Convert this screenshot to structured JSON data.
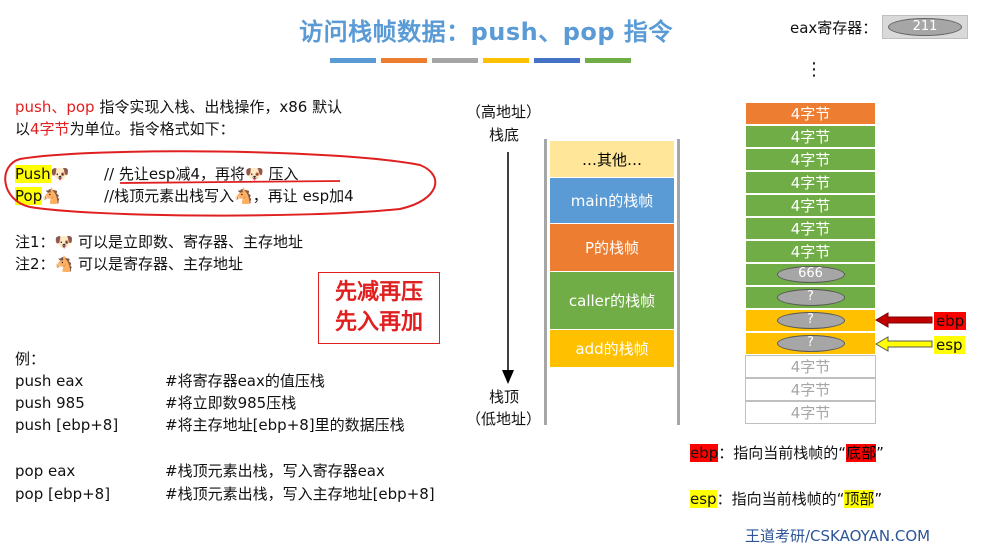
{
  "title": "访问栈帧数据：push、pop 指令",
  "title_bar_colors": [
    "#5B9BD5",
    "#ED7D31",
    "#A5A5A5",
    "#FFC000",
    "#4472C4",
    "#70AD47"
  ],
  "eax": {
    "label": "eax寄存器：",
    "value": "211"
  },
  "intro": {
    "line1_red": "push、pop",
    "line1_rest": " 指令实现入栈、出栈操作，x86 默认",
    "line2_pre": "以",
    "line2_red": "4字节",
    "line2_post": "为单位。指令格式如下："
  },
  "formats": {
    "push_label": "Push",
    "push_desc_a": "// 先让esp减4，再将",
    "push_desc_b": " 压入",
    "pop_label": "Pop",
    "pop_desc_a": "//栈顶元素出栈写入",
    "pop_desc_b": "，再让 esp加4"
  },
  "notes": {
    "note1_a": "注1：",
    "note1_b": " 可以是立即数、寄存器、主存地址",
    "note2_a": "注2：",
    "note2_b": " 可以是寄存器、主存地址"
  },
  "tip": {
    "line1": "先减再压",
    "line2": "先入再加"
  },
  "examples": {
    "header": "例：",
    "rows": [
      {
        "code": "push eax",
        "comment": "#将寄存器eax的值压栈"
      },
      {
        "code": "push 985",
        "comment": "#将立即数985压栈"
      },
      {
        "code": "push [ebp+8]",
        "comment": "#将主存地址[ebp+8]里的数据压栈"
      },
      {
        "code": "pop eax",
        "comment": "#栈顶元素出栈，写入寄存器eax"
      },
      {
        "code": "pop [ebp+8]",
        "comment": "#栈顶元素出栈，写入主存地址[ebp+8]"
      }
    ]
  },
  "mid_stack": {
    "top_label_1": "（高地址）",
    "top_label_2": "栈底",
    "bottom_label_1": "栈顶",
    "bottom_label_2": "（低地址）",
    "blocks": [
      {
        "label": "…其他…",
        "color": "#FFE699",
        "text_color": "#000000"
      },
      {
        "label": "main的栈帧",
        "color": "#5B9BD5",
        "text_color": "#ffffff"
      },
      {
        "label": "P的栈帧",
        "color": "#ED7D31",
        "text_color": "#ffffff"
      },
      {
        "label": "caller的栈帧",
        "color": "#70AD47",
        "text_color": "#ffffff"
      },
      {
        "label": "add的栈帧",
        "color": "#FFC000",
        "text_color": "#ffffff"
      }
    ]
  },
  "right_stack": {
    "ellipsis": "⋮",
    "cells": [
      {
        "label": "4字节",
        "style": "orange"
      },
      {
        "label": "4字节",
        "style": "green"
      },
      {
        "label": "4字节",
        "style": "green"
      },
      {
        "label": "4字节",
        "style": "green"
      },
      {
        "label": "4字节",
        "style": "green"
      },
      {
        "label": "4字节",
        "style": "green"
      },
      {
        "label": "4字节",
        "style": "green"
      },
      {
        "label": "666",
        "style": "green",
        "oval": true
      },
      {
        "label": "?",
        "style": "green",
        "oval": true
      },
      {
        "label": "?",
        "style": "yellow",
        "oval": true
      },
      {
        "label": "?",
        "style": "yellow",
        "oval": true
      },
      {
        "label": "4字节",
        "style": "empty"
      },
      {
        "label": "4字节",
        "style": "empty"
      },
      {
        "label": "4字节",
        "style": "empty"
      }
    ],
    "ebp_label": "ebp",
    "esp_label": "esp"
  },
  "legend": {
    "ebp_tag": "ebp",
    "ebp_text": "：指向当前栈帧的“",
    "ebp_key": "底部",
    "ebp_close": "”",
    "esp_tag": "esp",
    "esp_text": "：指向当前栈帧的“",
    "esp_key": "顶部",
    "esp_close": "”"
  },
  "footer": "王道考研/CSKAOYAN.COM"
}
